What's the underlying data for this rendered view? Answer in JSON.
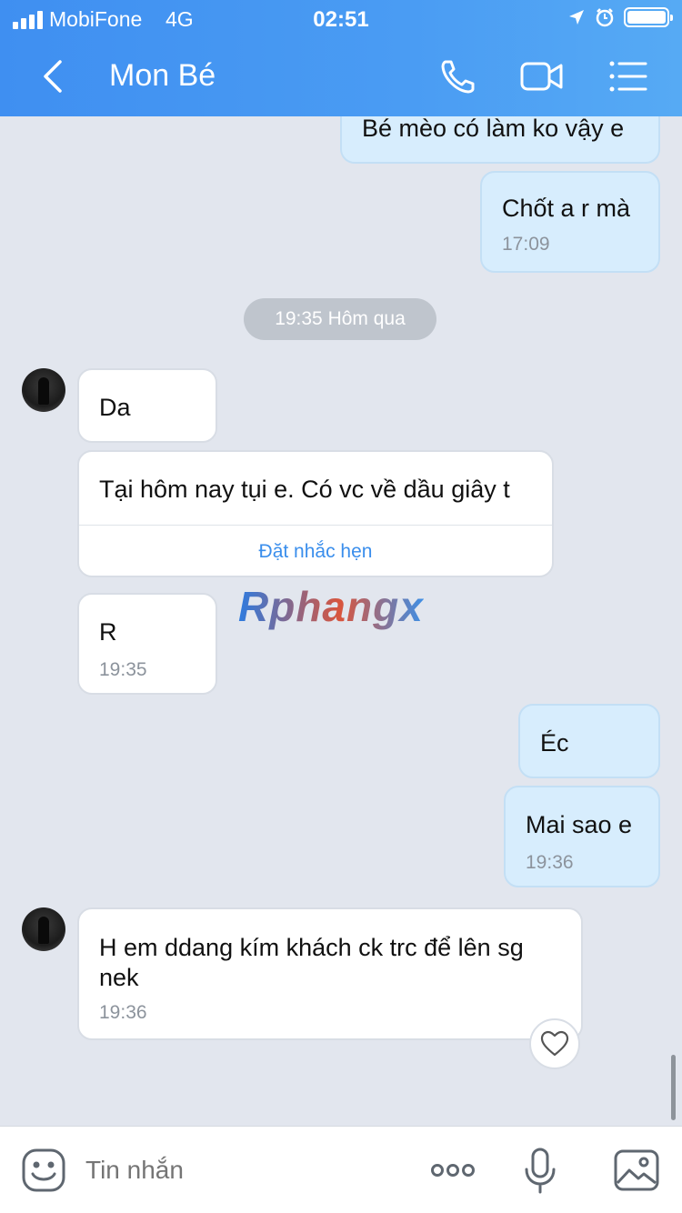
{
  "status_bar": {
    "carrier": "MobiFone",
    "network": "4G",
    "time": "02:51"
  },
  "header": {
    "title": "Mon Bé"
  },
  "messages": [
    {
      "text": "Bé mèo có làm ko vậy e"
    },
    {
      "text": "Chốt a r mà",
      "time": "17:09"
    },
    {
      "text": "Da"
    },
    {
      "text": "Tại hôm nay tụi e. Có vc về dầu giây t",
      "action": "Đặt nhắc hẹn"
    },
    {
      "text": "R",
      "time": "19:35"
    },
    {
      "text": "Éc"
    },
    {
      "text": "Mai sao e",
      "time": "19:36"
    },
    {
      "text": "H em ddang kím khách ck trc để lên sg nek",
      "time": "19:36"
    }
  ],
  "separator": "19:35 Hôm qua",
  "watermark": "Rphangx",
  "composer": {
    "placeholder": "Tin nhắn"
  },
  "icons": {
    "back": "chevron-left-icon",
    "call": "phone-icon",
    "video": "video-camera-icon",
    "menu": "list-menu-icon",
    "emoji": "sticker-face-icon",
    "more": "more-dots-icon",
    "mic": "microphone-icon",
    "gallery": "image-icon",
    "reaction": "heart-icon"
  },
  "colors": {
    "header": "#4a9cf3",
    "outgoing": "#d7edfd",
    "incoming": "#ffffff",
    "link": "#3a8eec",
    "background": "#e2e6ee"
  }
}
